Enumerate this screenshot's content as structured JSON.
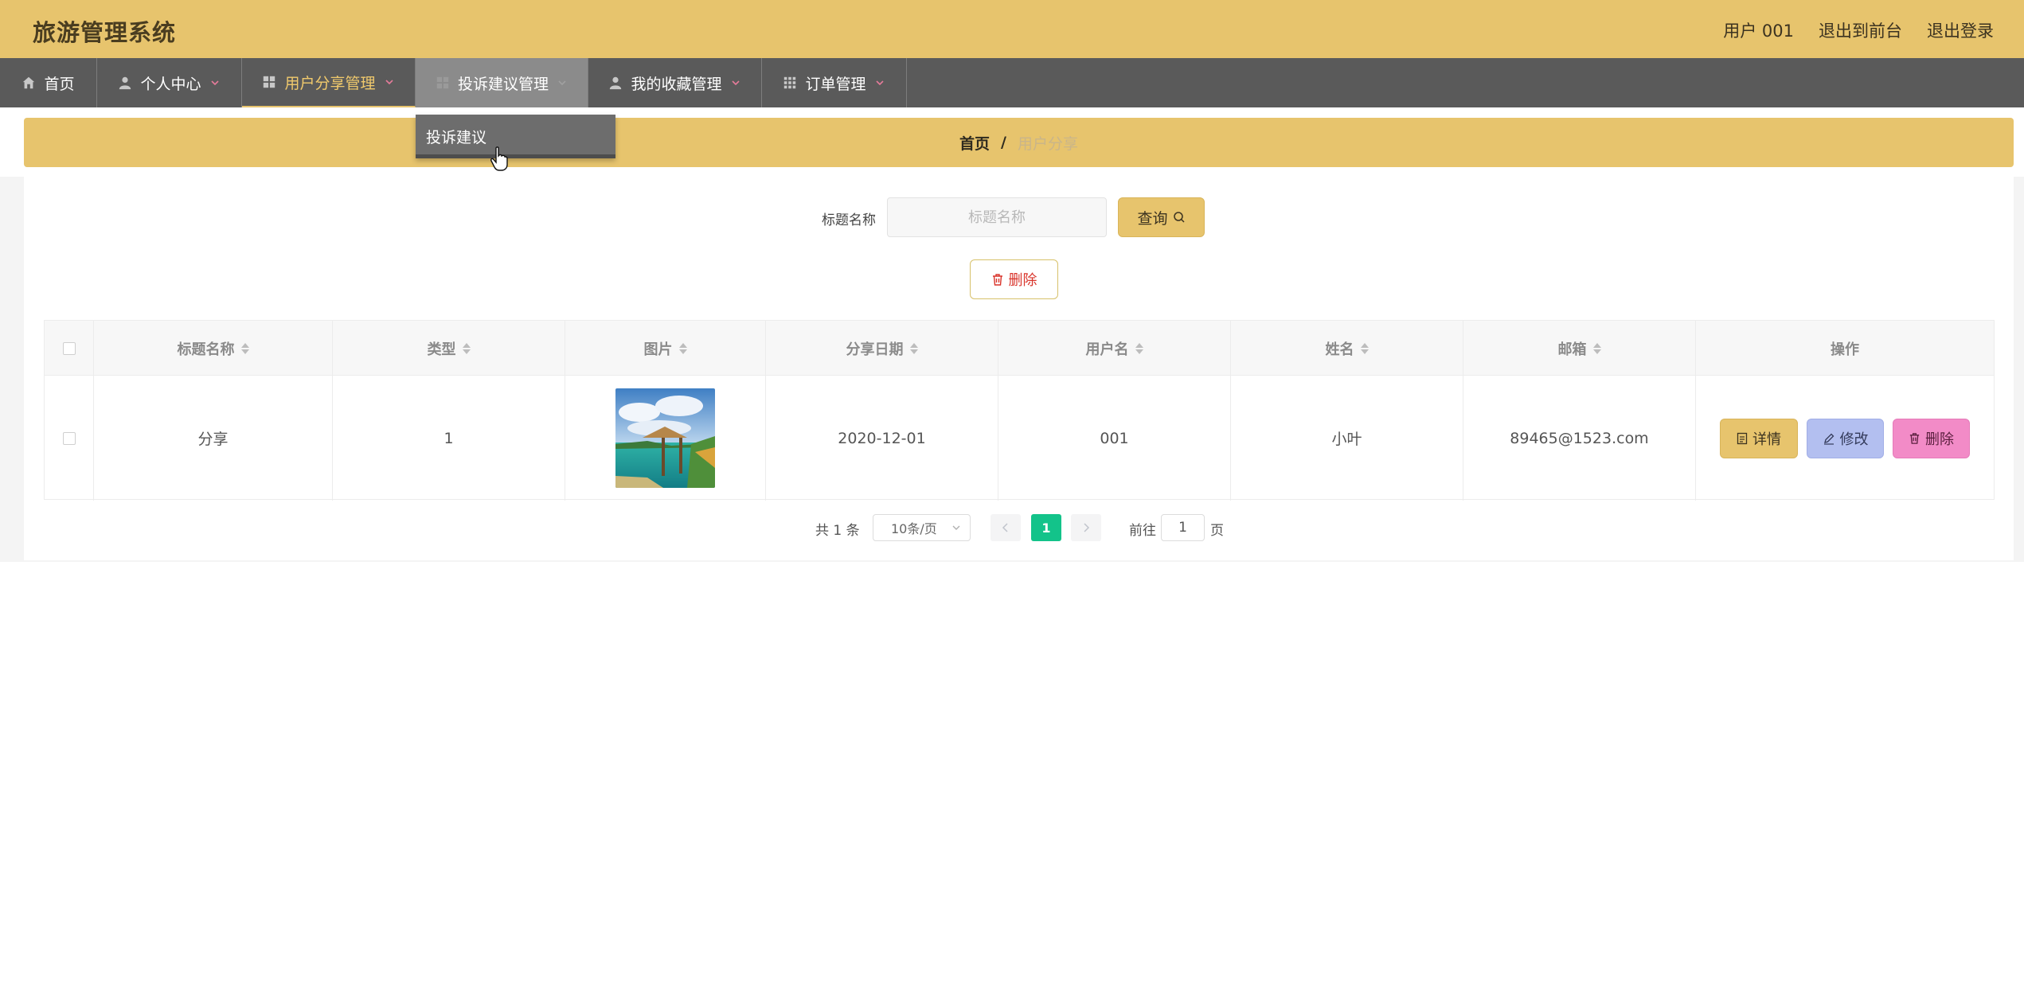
{
  "header": {
    "title": "旅游管理系统",
    "user_label": "用户 001",
    "to_front_label": "退出到前台",
    "logout_label": "退出登录",
    "bg_color": "#e7c46d"
  },
  "nav": {
    "items": [
      {
        "label": "首页",
        "icon": "home-icon"
      },
      {
        "label": "个人中心",
        "icon": "user-icon"
      },
      {
        "label": "用户分享管理",
        "icon": "grid-icon"
      },
      {
        "label": "投诉建议管理",
        "icon": "grid-icon"
      },
      {
        "label": "我的收藏管理",
        "icon": "user-icon"
      },
      {
        "label": "订单管理",
        "icon": "apps-icon"
      }
    ],
    "dropdown_item": "投诉建议"
  },
  "breadcrumb": {
    "home": "首页",
    "separator": "/",
    "current": "用户分享"
  },
  "search": {
    "label": "标题名称",
    "placeholder": "标题名称",
    "button_label": "查询"
  },
  "toolbar": {
    "delete_label": "删除"
  },
  "table": {
    "columns": [
      "标题名称",
      "类型",
      "图片",
      "分享日期",
      "用户名",
      "姓名",
      "邮箱",
      "操作"
    ],
    "rows": [
      {
        "title": "分享",
        "type": "1",
        "image": "beach-hut-photo",
        "date": "2020-12-01",
        "username": "001",
        "name": "小叶",
        "email": "89465@1523.com",
        "actions": {
          "detail": "详情",
          "edit": "修改",
          "delete": "删除"
        }
      }
    ]
  },
  "pagination": {
    "total_text": "共 1 条",
    "page_size": "10条/页",
    "current_page": "1",
    "goto_label": "前往",
    "goto_value": "1",
    "page_unit": "页",
    "active_color": "#13c38a"
  }
}
